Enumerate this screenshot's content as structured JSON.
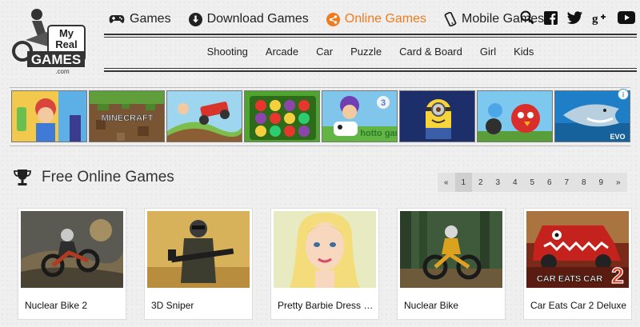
{
  "logo": {
    "label": "My Real GAMES .com"
  },
  "nav": {
    "games": "Games",
    "download": "Download Games",
    "online": "Online Games",
    "mobile": "Mobile Games",
    "active_color": "#f07b1e"
  },
  "social": [
    "search-icon",
    "facebook-icon",
    "twitter-icon",
    "google-plus-icon",
    "youtube-icon"
  ],
  "categories": [
    "Shooting",
    "Arcade",
    "Car",
    "Puzzle",
    "Card & Board",
    "Girl",
    "Kids"
  ],
  "strip_watermark": "hotto games",
  "section": {
    "title": "Free Online Games"
  },
  "pager": {
    "prev": "«",
    "pages": [
      "1",
      "2",
      "3",
      "4",
      "5",
      "6",
      "7",
      "8",
      "9"
    ],
    "next": "»",
    "current": "1"
  },
  "cards": [
    {
      "name": "Nuclear Bike 2"
    },
    {
      "name": "3D Sniper"
    },
    {
      "name": "Pretty Barbie Dress Up"
    },
    {
      "name": "Nuclear Bike"
    },
    {
      "name": "Car Eats Car 2 Deluxe"
    }
  ],
  "card_captions": {
    "car_eats_car_title": "CAR EATS CAR",
    "car_eats_car_num": "2",
    "minecraft": "MINECRAFT",
    "evo": "EVO",
    "cow_num": "3"
  }
}
